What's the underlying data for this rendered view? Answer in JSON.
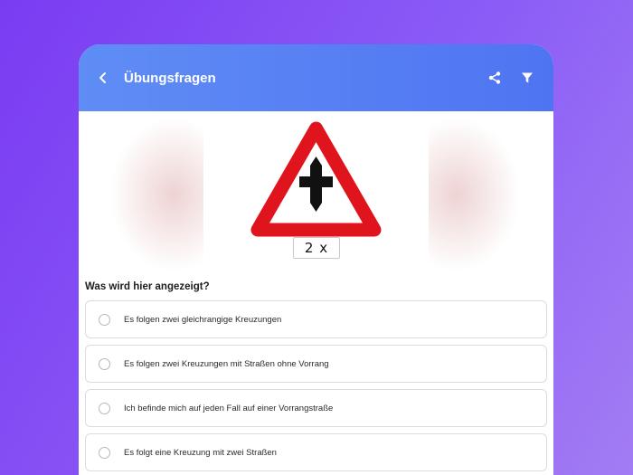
{
  "header": {
    "title": "Übungsfragen",
    "back_icon": "chevron-left-icon",
    "actions": [
      {
        "name": "share",
        "icon": "share-icon"
      },
      {
        "name": "filter",
        "icon": "filter-icon"
      }
    ]
  },
  "sign": {
    "type": "priority-crossroad-warning-sign",
    "plate_text": "2 x",
    "colors": {
      "border": "#e0141c",
      "symbol": "#111111"
    }
  },
  "question": {
    "text": "Was wird hier angezeigt?",
    "answers": [
      {
        "label": "Es folgen zwei gleichrangige Kreuzungen",
        "selected": false
      },
      {
        "label": "Es folgen zwei Kreuzungen mit Straßen ohne Vorrang",
        "selected": false
      },
      {
        "label": "Ich befinde mich auf jeden Fall auf einer Vorrangstraße",
        "selected": false
      },
      {
        "label": "Es folgt eine Kreuzung mit zwei Straßen",
        "selected": false
      }
    ]
  },
  "colors": {
    "appbar_start": "#5f8df5",
    "appbar_end": "#4f74f2",
    "background_start": "#7a3cf2",
    "background_end": "#a27cf4"
  }
}
